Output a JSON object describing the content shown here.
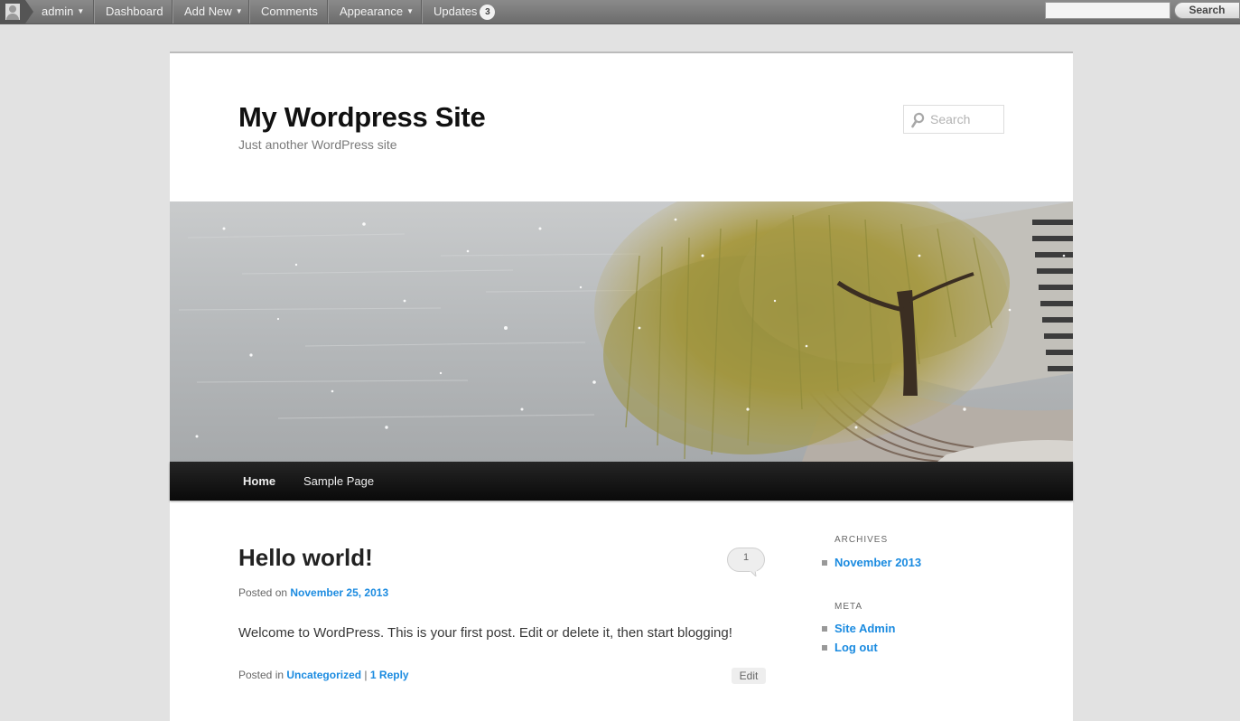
{
  "admin_bar": {
    "user": "admin",
    "dashboard": "Dashboard",
    "add_new": "Add New",
    "comments": "Comments",
    "appearance": "Appearance",
    "updates": "Updates",
    "updates_count": "3",
    "search_button": "Search",
    "search_value": ""
  },
  "site": {
    "title": "My Wordpress Site",
    "description": "Just another WordPress site",
    "search_placeholder": "Search"
  },
  "nav": {
    "items": [
      {
        "label": "Home"
      },
      {
        "label": "Sample Page"
      }
    ]
  },
  "post": {
    "title": "Hello world!",
    "comment_count": "1",
    "posted_on": "Posted on",
    "date": "November 25, 2013",
    "content": "Welcome to WordPress. This is your first post. Edit or delete it, then start blogging!",
    "posted_in": "Posted in",
    "category": "Uncategorized",
    "separator": "|",
    "reply": "1 Reply",
    "edit": "Edit"
  },
  "sidebar": {
    "archives_title": "ARCHIVES",
    "archives": [
      "November 2013"
    ],
    "meta_title": "META",
    "meta": [
      "Site Admin",
      "Log out"
    ]
  },
  "colors": {
    "link": "#1b8be0",
    "admin_bar": "#777777",
    "nav_bar": "#111111"
  }
}
